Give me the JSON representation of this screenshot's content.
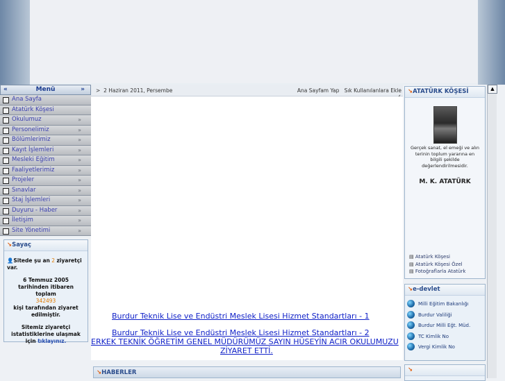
{
  "menu": {
    "title": "Menü",
    "left_arrow": "«",
    "right_arrow": "»",
    "items": [
      {
        "label": "Ana Sayfa",
        "arrow": ""
      },
      {
        "label": "Atatürk Köşesi",
        "arrow": ""
      },
      {
        "label": "Okulumuz",
        "arrow": "»"
      },
      {
        "label": "Personelimiz",
        "arrow": "»"
      },
      {
        "label": "Bölümlerimiz",
        "arrow": "»"
      },
      {
        "label": "Kayıt İşlemleri",
        "arrow": "»"
      },
      {
        "label": "Mesleki Eğitim",
        "arrow": "»"
      },
      {
        "label": "Faaliyetlerimiz",
        "arrow": "»"
      },
      {
        "label": "Projeler",
        "arrow": "»"
      },
      {
        "label": "Sınavlar",
        "arrow": "»"
      },
      {
        "label": "Staj İşlemleri",
        "arrow": "»"
      },
      {
        "label": "Duyuru - Haber",
        "arrow": "»"
      },
      {
        "label": "İletişim",
        "arrow": "»"
      },
      {
        "label": "Site Yönetimi",
        "arrow": "»"
      }
    ]
  },
  "sayac": {
    "title": "Sayaç",
    "marker": "↘",
    "online_pre": "Sitede şu an",
    "online_count": "2",
    "online_post": "ziyaretçi var.",
    "since": "6 Temmuz 2005 tarihinden itibaren toplam",
    "total": "342493",
    "visited": "kişi tarafından ziyaret edilmiştir.",
    "stats_pre": "Sitemiz ziyaretçi istatistiklerine ulaşmak için",
    "stats_link": "tıklayınız."
  },
  "topbar": {
    "arrow": ">",
    "date": "2 Haziran 2011, Persembe",
    "homepage": "Ana Sayfam Yap",
    "favorites": "Sık Kullanılanlara Ekle",
    "chevron": "‹"
  },
  "center": {
    "links": [
      "Burdur Teknik Lise ve Endüstri Meslek Lisesi Hizmet Standartları - 1",
      "Burdur Teknik Lise ve Endüstri Meslek Lisesi Hizmet Standartları - 2",
      "ERKEK TEKNİK ÖĞRETİM GENEL MÜDÜRÜMÜZ SAYIN HÜSEYİN ACIR OKULUMUZU",
      "ZİYARET ETTİ."
    ],
    "haberler_title": "HABERLER",
    "haberler_marker": "↘"
  },
  "ataturk": {
    "title": "ATATÜRK KÖŞESİ",
    "marker": "↘",
    "quote": "Gerçek sanat, el emeği ve alın terinin toplum yararına en bilgili şekilde değerlendirilmesidir.",
    "signature": "M. K. ATATÜRK",
    "links": [
      "Atatürk Köşesi",
      "Atatürk Köşesi Özel",
      "Fotoğraflarla Atatürk"
    ]
  },
  "edevlet": {
    "title": "e-devlet",
    "marker": "↘",
    "items": [
      "Milli Eğitim Bakanlığı",
      "Burdur Valiliği",
      "Burdur Milli Eğt. Müd.",
      "TC Kimlik No",
      "Vergi Kimlik No"
    ]
  },
  "box3": {
    "marker": "↘"
  },
  "scrollbar": {
    "up": "▲"
  }
}
